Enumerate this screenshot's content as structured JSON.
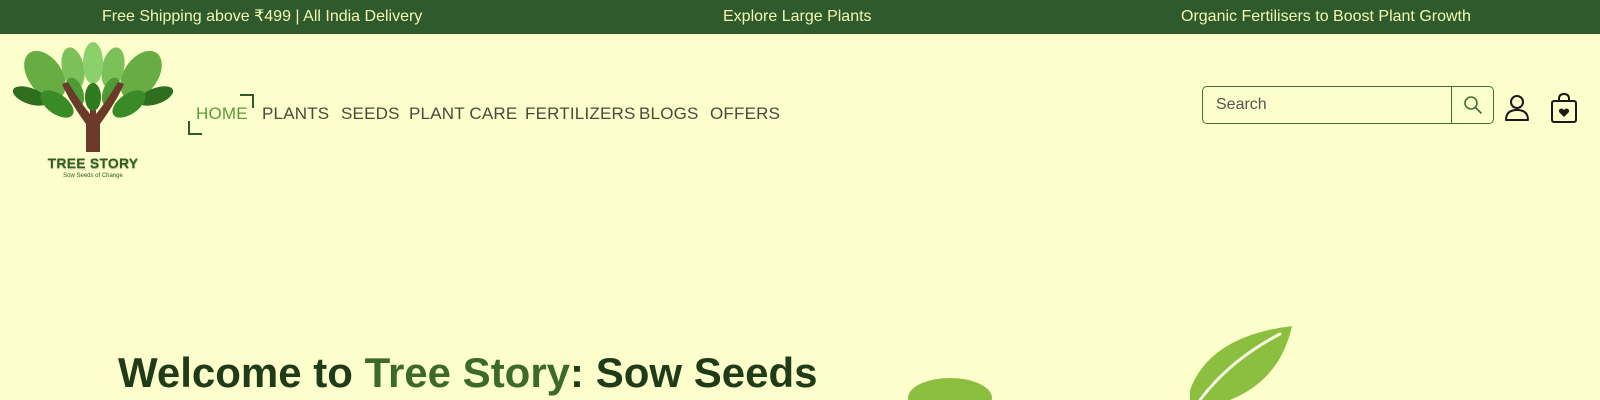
{
  "announcements": [
    "Free Shipping above ₹499 | All India Delivery",
    "Explore Large Plants",
    "Organic Fertilisers to Boost Plant Growth"
  ],
  "logo": {
    "name": "TREE STORY",
    "tagline": "Sow Seeds of Change"
  },
  "nav": {
    "items": [
      {
        "label": "HOME",
        "active": true
      },
      {
        "label": "PLANTS"
      },
      {
        "label": "SEEDS"
      },
      {
        "label": "PLANT CARE"
      },
      {
        "label": "FERTILIZERS"
      },
      {
        "label": "BLOGS"
      },
      {
        "label": "OFFERS"
      }
    ]
  },
  "search": {
    "placeholder": "Search",
    "icon": "search-icon"
  },
  "header_icons": {
    "account": "user-icon",
    "cart": "shopping-bag-icon"
  },
  "hero": {
    "title_prefix": "Welcome to ",
    "title_brand": "Tree Story",
    "title_suffix": ": Sow Seeds"
  },
  "colors": {
    "announcement_bg": "#2f5a2b",
    "announcement_text": "#f3f7b3",
    "page_bg": "#fcfecb",
    "nav_active": "#5a9c3c",
    "heading": "#1f3b17",
    "brand_highlight": "#3c6a2c",
    "leaf": "#8cbf3f"
  }
}
